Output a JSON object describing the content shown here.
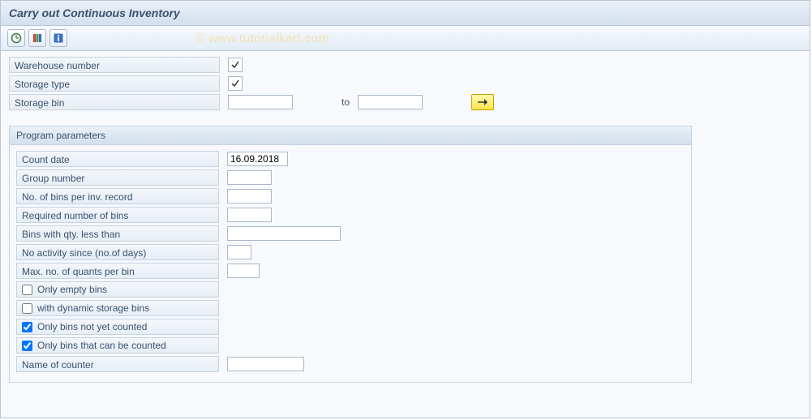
{
  "title": "Carry out Continuous Inventory",
  "watermark": "© www.tutorialkart.com",
  "toolbar": {
    "execute_icon": "execute",
    "variants_icon": "variants",
    "info_icon": "info"
  },
  "selection": {
    "warehouse_label": "Warehouse number",
    "warehouse_value": "",
    "warehouse_required": true,
    "storage_type_label": "Storage type",
    "storage_type_value": "",
    "storage_type_required": true,
    "storage_bin_label": "Storage bin",
    "storage_bin_from": "",
    "storage_bin_to_label": "to",
    "storage_bin_to": ""
  },
  "group": {
    "title": "Program parameters",
    "count_date_label": "Count date",
    "count_date_value": "16.09.2018",
    "group_number_label": "Group number",
    "group_number_value": "",
    "bins_per_record_label": "No. of bins per inv. record",
    "bins_per_record_value": "",
    "required_bins_label": "Required number of bins",
    "required_bins_value": "",
    "qty_less_label": "Bins with qty. less than",
    "qty_less_value": "",
    "no_activity_label": "No activity since (no.of days)",
    "no_activity_value": "",
    "max_quants_label": "Max. no. of quants per bin",
    "max_quants_value": "",
    "only_empty_label": "Only empty bins",
    "only_empty_checked": false,
    "with_dynamic_label": "with dynamic storage bins",
    "with_dynamic_checked": false,
    "not_counted_label": "Only bins not yet counted",
    "not_counted_checked": true,
    "can_be_counted_label": "Only bins that can be counted",
    "can_be_counted_checked": true,
    "counter_name_label": "Name of counter",
    "counter_name_value": ""
  }
}
